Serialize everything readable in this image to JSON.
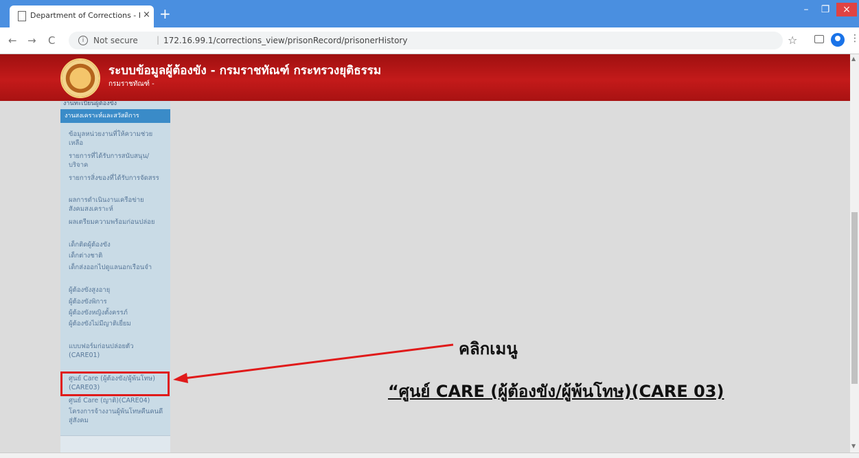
{
  "browser": {
    "tab_title": "Department of Corrections - Pris",
    "tab_close": "×",
    "new_tab": "+",
    "back": "←",
    "forward": "→",
    "reload": "C",
    "info": "i",
    "security_label": "Not secure",
    "url": "172.16.99.1/corrections_view/prisonRecord/prisonerHistory",
    "win_min": "–",
    "win_max": "❐",
    "win_close": "×",
    "star": "☆",
    "menu": "⋮"
  },
  "header": {
    "title": "ระบบข้อมูลผู้ต้องขัง - กรมราชทัณฑ์ กระทรวงยุติธรรม",
    "subtitle": "กรมราชทัณฑ์ -"
  },
  "sidebar": {
    "top_item": "งานทะเบียนผู้ต้องขัง",
    "section_header": "งานสงเคราะห์และสวัสดิการ",
    "items": [
      "ข้อมูลหน่วยงานที่ให้ความช่วยเหลือ",
      "รายการที่ได้รับการสนับสนุน/บริจาค",
      "รายการสิ่งของที่ได้รับการจัดสรร",
      "ผลการดำเนินงานเครือข่ายสังคมสงเคราะห์",
      "ผลเตรียมความพร้อมก่อนปล่อย",
      "เด็กติดผู้ต้องขัง",
      "เด็กต่างชาติ",
      "เด็กส่งออกไปดูแลนอกเรือนจำ",
      "ผู้ต้องขังสูงอายุ",
      "ผู้ต้องขังพิการ",
      "ผู้ต้องขังหญิงตั้งครรภ์",
      "ผู้ต้องขังไม่มีญาติเยี่ยม",
      "แบบฟอร์มก่อนปล่อยตัว (CARE01)",
      "ศูนย์ Care (ผู้ต้องขัง/ผู้พ้นโทษ)(CARE03)",
      "ศูนย์ Care (ญาติ)(CARE04)",
      "โครงการจ้างงานผู้พ้นโทษคืนคนดีสู่สังคม"
    ]
  },
  "annotation": {
    "line1": "คลิกเมนู",
    "line2": "“ศูนย์ CARE (ผู้ต้องขัง/ผู้พ้นโทษ)(CARE 03)",
    "color": "#e01a1a"
  }
}
